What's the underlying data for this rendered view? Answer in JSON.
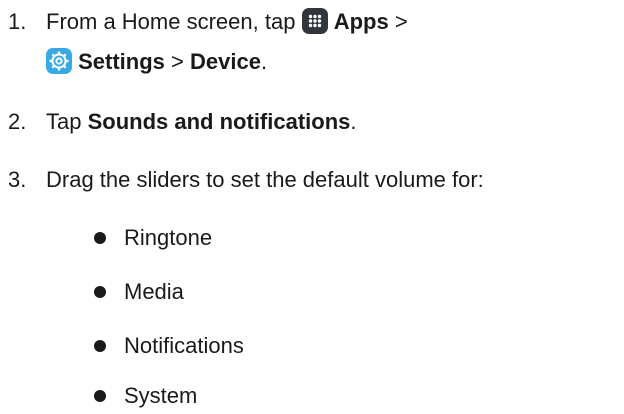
{
  "steps": [
    {
      "number": "1.",
      "prefix": "From a Home screen, tap",
      "apps_label": "Apps",
      "sep1": ">",
      "settings_label": "Settings",
      "sep2": ">",
      "device_label": "Device",
      "end": ".",
      "icons": [
        "apps-grid-icon",
        "settings-gear-icon"
      ]
    },
    {
      "number": "2.",
      "prefix": "Tap",
      "bold": "Sounds and notifications",
      "end": "."
    },
    {
      "number": "3.",
      "text": "Drag the sliders to set the default volume for:"
    }
  ],
  "bullets": [
    "Ringtone",
    "Media",
    "Notifications",
    "System"
  ],
  "colors": {
    "text": "#1a1a1a",
    "apps_icon_bg": "#30363b",
    "settings_icon_bg": "#39a8e6"
  }
}
